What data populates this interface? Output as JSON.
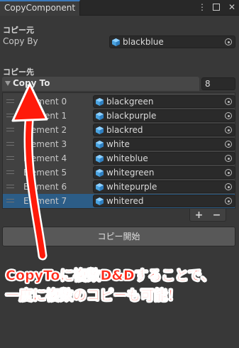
{
  "window": {
    "tab_title": "CopyComponent",
    "menu_icon": "kebab-menu-icon",
    "maximize_icon": "maximize-icon",
    "close_icon": "close-icon"
  },
  "source": {
    "section_title": "コピー元",
    "label": "Copy By",
    "value": "blackblue",
    "icon": "prefab-cube-icon"
  },
  "destination": {
    "section_title": "コピー先",
    "list_label": "Copy To",
    "size": "8",
    "elements": [
      {
        "label": "Element 0",
        "value": "blackgreen"
      },
      {
        "label": "Element 1",
        "value": "blackpurple"
      },
      {
        "label": "Element 2",
        "value": "blackred"
      },
      {
        "label": "Element 3",
        "value": "white"
      },
      {
        "label": "Element 4",
        "value": "whiteblue"
      },
      {
        "label": "Element 5",
        "value": "whitegreen"
      },
      {
        "label": "Element 6",
        "value": "whitepurple"
      },
      {
        "label": "Element 7",
        "value": "whitered"
      }
    ],
    "selected_index": 7,
    "add_label": "+",
    "remove_label": "−"
  },
  "actions": {
    "copy_button": "コピー開始"
  },
  "annotation": {
    "line1": "CopyToに複数D&Dすることで、",
    "line2": "一度に複数のコピーも可能！",
    "color": "#ff2a1a"
  },
  "colors": {
    "accent": "#3a79bb",
    "selection": "#2c5d87",
    "cube": "#4aa3e0"
  }
}
